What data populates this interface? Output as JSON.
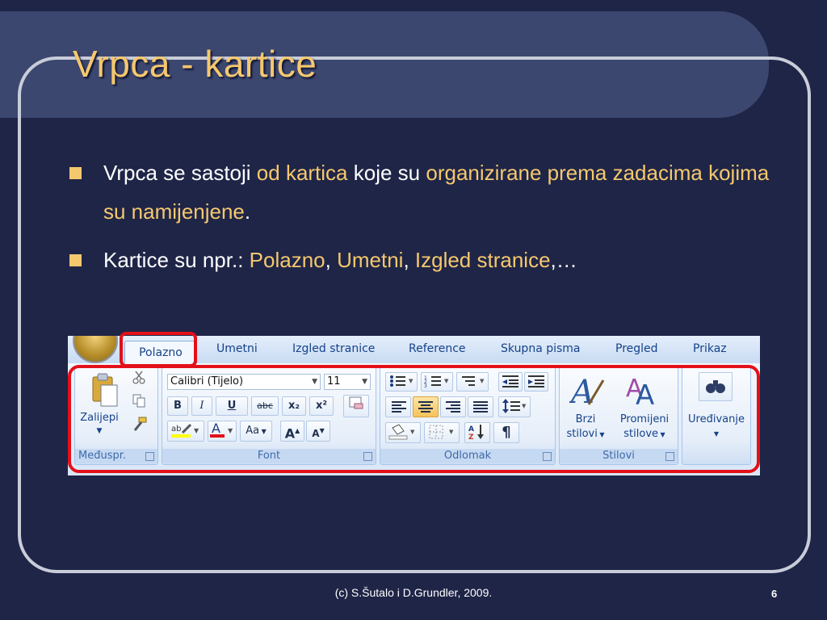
{
  "slide": {
    "title": "Vrpca - kartice",
    "bullets": [
      {
        "parts": [
          {
            "text": "Vrpca se sastoji ",
            "hl": false
          },
          {
            "text": "od kartica",
            "hl": true
          },
          {
            "text": " koje su ",
            "hl": false
          },
          {
            "text": "organizirane prema zadacima kojima su namijenjene",
            "hl": true
          },
          {
            "text": ".",
            "hl": false
          }
        ]
      },
      {
        "parts": [
          {
            "text": "Kartice su npr.: ",
            "hl": false
          },
          {
            "text": "Polazno",
            "hl": true
          },
          {
            "text": ", ",
            "hl": false
          },
          {
            "text": "Umetni",
            "hl": true
          },
          {
            "text": ", ",
            "hl": false
          },
          {
            "text": "Izgled stranice",
            "hl": true
          },
          {
            "text": ",…",
            "hl": false
          }
        ]
      }
    ],
    "footer": "(c) S.Šutalo i D.Grundler, 2009.",
    "page_number": "6"
  },
  "ribbon": {
    "tabs": [
      "Polazno",
      "Umetni",
      "Izgled stranice",
      "Reference",
      "Skupna pisma",
      "Pregled",
      "Prikaz"
    ],
    "active_tab": "Polazno",
    "groups": {
      "clipboard": {
        "label": "Međuspr.",
        "paste": "Zalijepi"
      },
      "font": {
        "label": "Font",
        "font_name": "Calibri (Tijelo)",
        "font_size": "11",
        "bold": "B",
        "italic": "I",
        "underline": "U",
        "strike": "abc",
        "subscript": "x₂",
        "superscript": "x²",
        "change_case": "Aa",
        "grow": "A",
        "shrink": "A"
      },
      "paragraph": {
        "label": "Odlomak",
        "pilcrow": "¶"
      },
      "styles": {
        "label": "Stilovi",
        "quick_styles_1": "Brzi",
        "quick_styles_2": "stilovi",
        "change_styles_1": "Promijeni",
        "change_styles_2": "stilove"
      },
      "editing": {
        "label": "Uređivanje"
      }
    }
  },
  "colors": {
    "background": "#1f2547",
    "title_band": "#3c4770",
    "accent": "#f5c86e",
    "highlight_box": "#e3101a"
  }
}
